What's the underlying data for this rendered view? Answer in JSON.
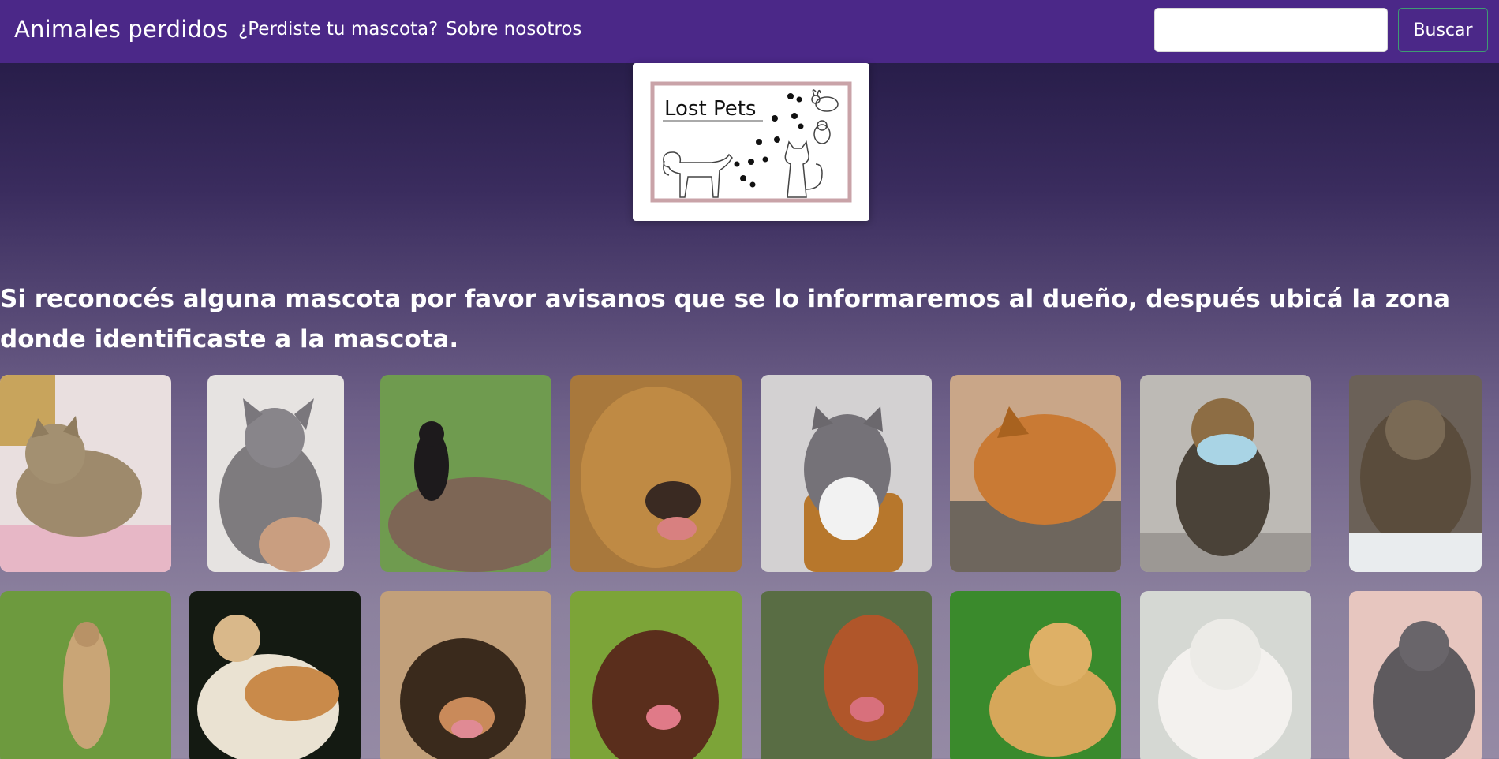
{
  "navbar": {
    "brand": "Animales perdidos",
    "links": [
      "¿Perdiste tu mascota?",
      "Sobre nosotros"
    ],
    "search_placeholder": "",
    "search_button": "Buscar",
    "background_color": "#4b2888"
  },
  "logo": {
    "text": "Lost Pets"
  },
  "main": {
    "headline": "Si reconocés alguna mascota por favor avisanos que se lo informaremos al dueño, después ubicá la zona donde identificaste a la mascota."
  },
  "pets": [
    {
      "animal": "cat",
      "description": "gray tabby cat lying on bed"
    },
    {
      "animal": "cat",
      "description": "gray cat held in hand"
    },
    {
      "animal": "dog",
      "description": "small black dog on grass"
    },
    {
      "animal": "dog",
      "description": "golden retriever face"
    },
    {
      "animal": "cat",
      "description": "gray and white cat in basket"
    },
    {
      "animal": "dog",
      "description": "sleeping orange dog"
    },
    {
      "animal": "dog",
      "description": "yorkshire terrier wearing face mask"
    },
    {
      "animal": "cat",
      "description": "tabby cat with crossed paws"
    },
    {
      "animal": "meerkat",
      "description": "standing meerkat"
    },
    {
      "animal": "cat",
      "description": "orange and white cat"
    },
    {
      "animal": "dog",
      "description": "black and tan puppy looking up"
    },
    {
      "animal": "dog",
      "description": "brown puppy"
    },
    {
      "animal": "dog",
      "description": "red dog smiling"
    },
    {
      "animal": "dog",
      "description": "golden puppy lying on grass"
    },
    {
      "animal": "dog",
      "description": "white puppy"
    },
    {
      "animal": "cat",
      "description": "gray cat"
    }
  ]
}
